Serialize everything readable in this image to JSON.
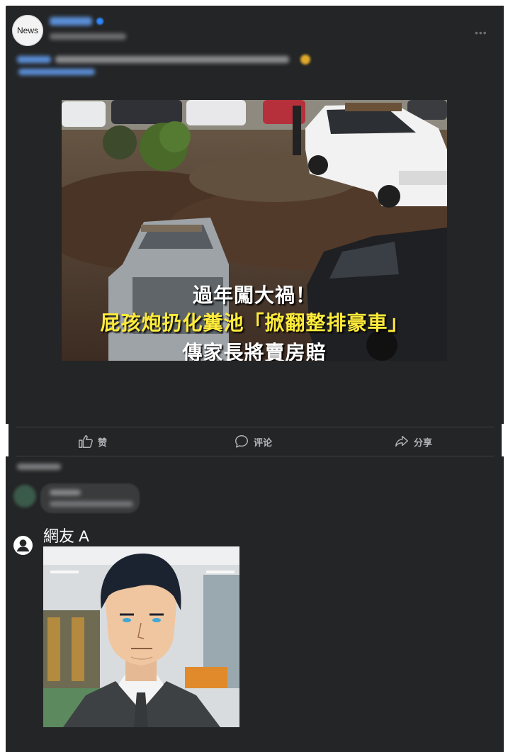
{
  "post": {
    "avatar_text": "News",
    "author": "██████",
    "meta": "██████████ · ◎",
    "text_line1": "██████ ██████████████ ████████████████ 😂",
    "text_line2": "( ████████ )",
    "more_icon": "ellipsis-icon",
    "image": {
      "caption_line1": "過年闖大禍！",
      "caption_line2": "屁孩炮扔化糞池「掀翻整排豪車」",
      "caption_line3": "傳家長將賣房賠"
    }
  },
  "actions": {
    "like_label": "赞",
    "comment_label": "评论",
    "share_label": "分享"
  },
  "comments_header": "█████ ▾",
  "comment": {
    "author": "█████",
    "text": "████ · ████"
  },
  "reply": {
    "name": "網友 A"
  },
  "colors": {
    "panel_bg": "#242526",
    "text_secondary": "#b0b3b8",
    "caption_yellow": "#ffeb3b"
  }
}
